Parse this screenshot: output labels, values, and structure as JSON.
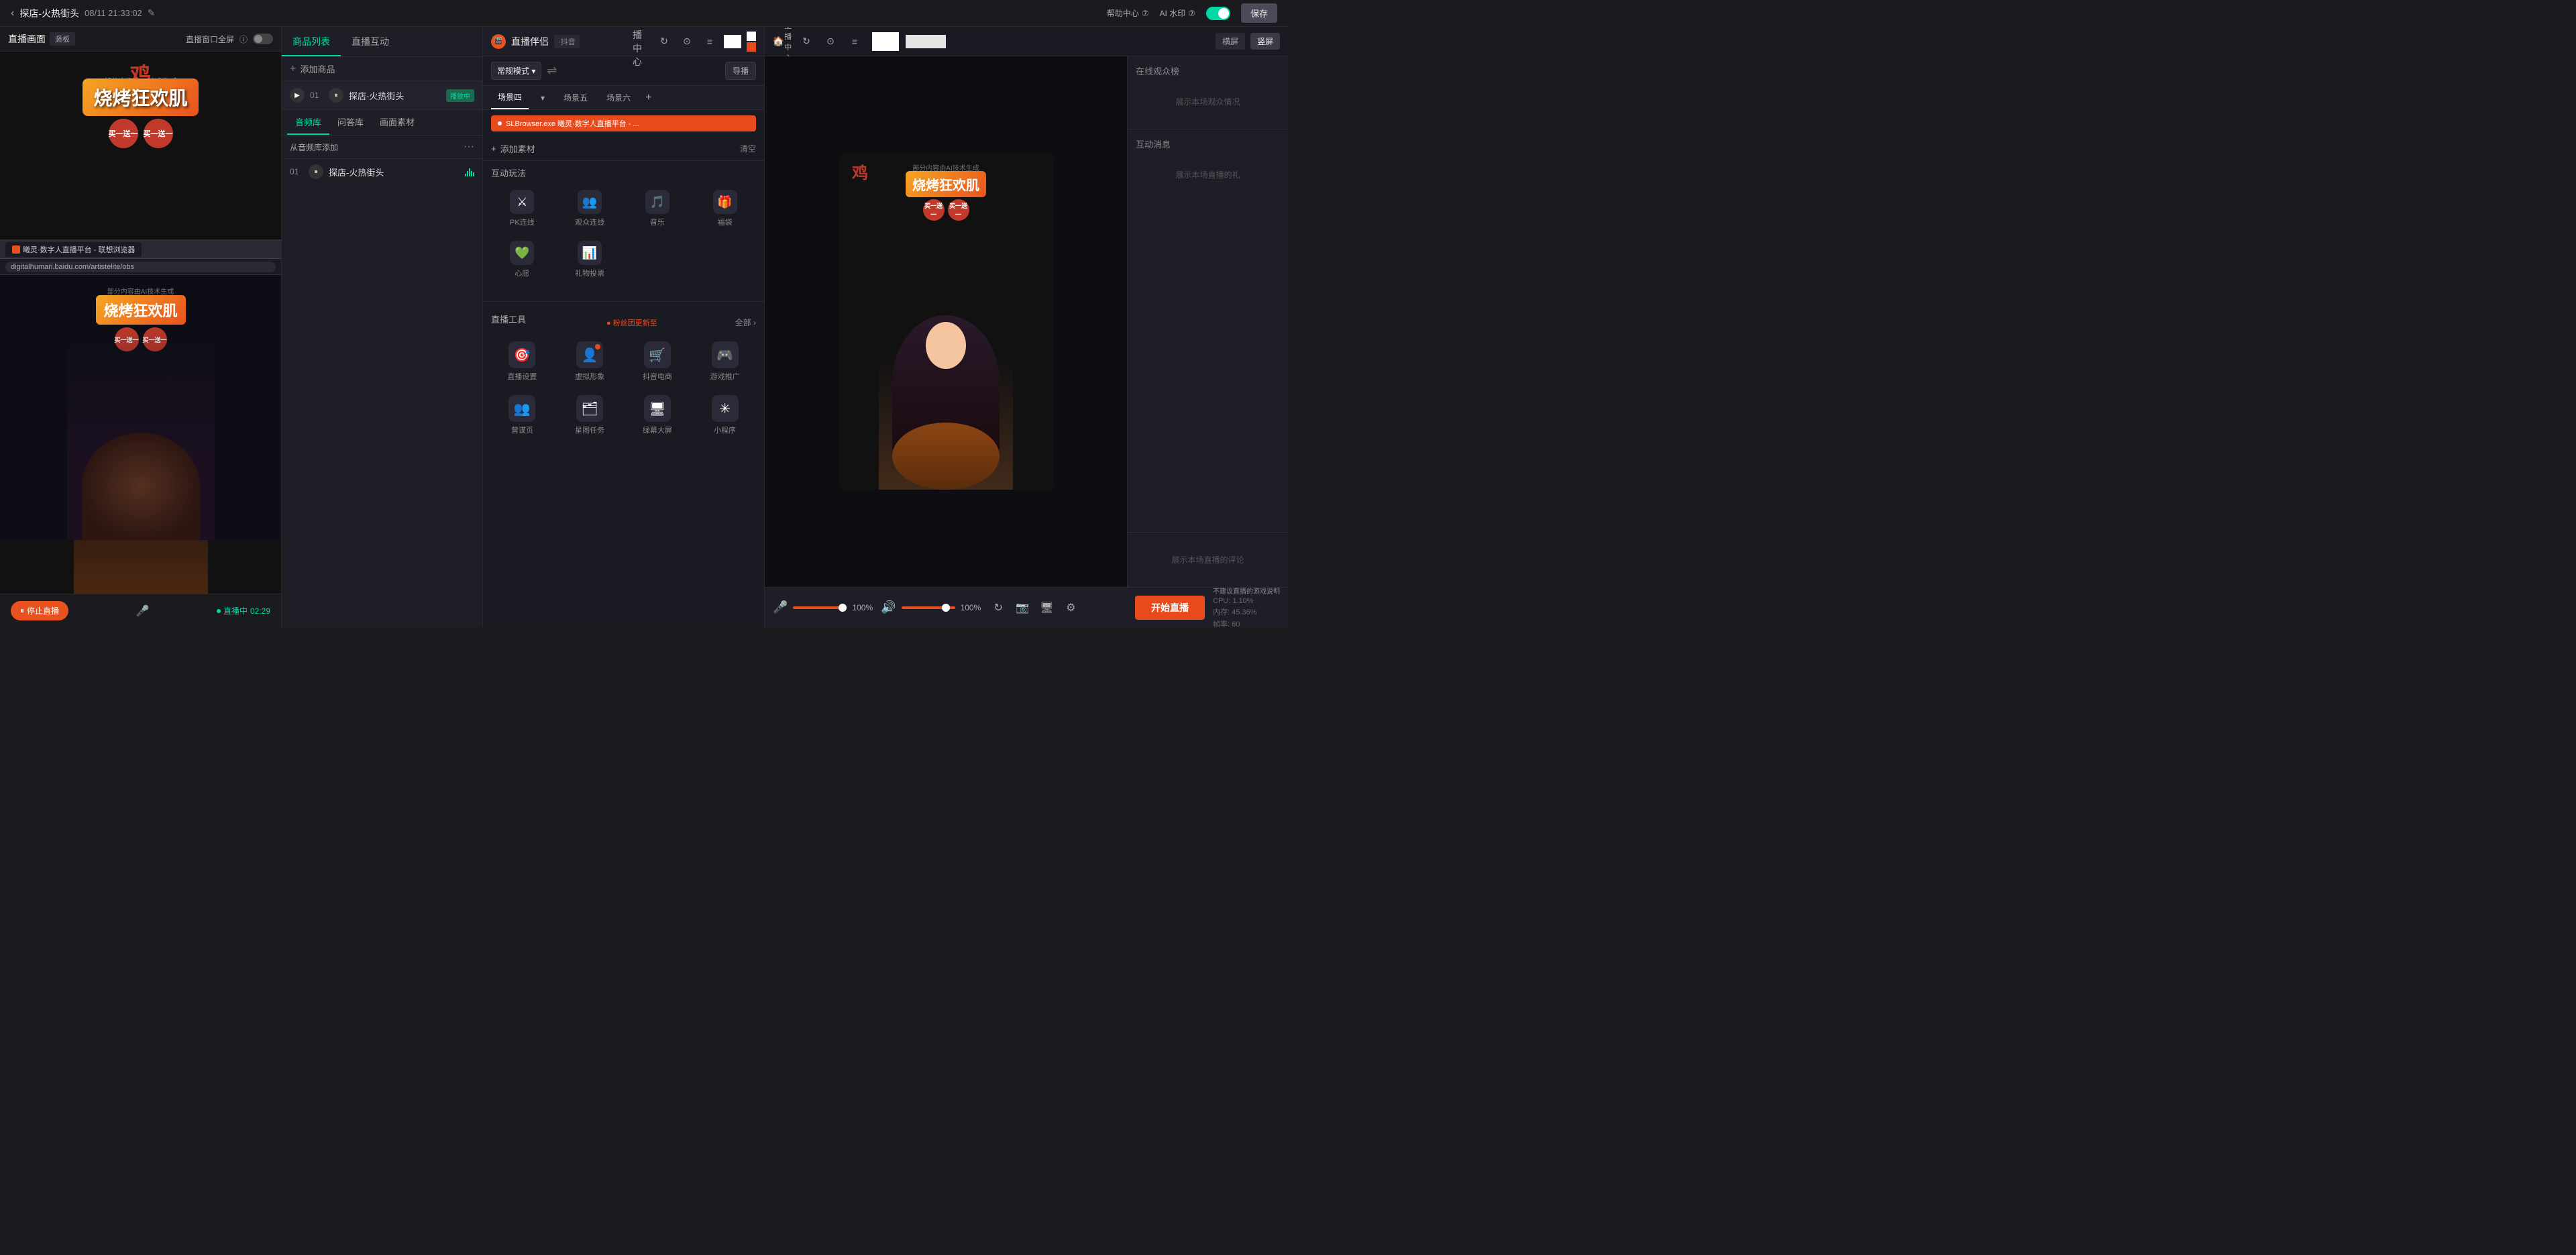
{
  "topBar": {
    "backArrow": "‹",
    "title": "探店-火热街头",
    "date": "08/11 21:33:02",
    "editIcon": "✎",
    "helpLabel": "帮助中心",
    "aiWaterLabel": "AI 水印",
    "saveLabel": "保存"
  },
  "leftPanel": {
    "title": "直播画面",
    "ratioLabel": "竖板",
    "fullscreenLabel": "直播窗口全屏",
    "aiText": "部分内容由AI技术生成",
    "bbqMainText": "烧烤狂欢肌",
    "bbqSub1": "买一送一",
    "bbqSub2": "买一送一",
    "browserTitle": "曦灵·数字人直播平台 - 联想浏览器",
    "browserUrl": "digitalhuman.baidu.com/artistelite/obs",
    "innerAiText": "部分内容由AI技术生成",
    "innerBbqText": "烧烤狂欢肌",
    "stopLiveLabel": "停止直播",
    "liveTimerLabel": "直播中",
    "liveTime": "02:29"
  },
  "middlePanel": {
    "tab1": "商品列表",
    "tab2": "直播互动",
    "addProductLabel": "添加商品",
    "product1Num": "01",
    "product1Name": "探店-火热街头",
    "product1Status": "播放中",
    "subTab1": "音频库",
    "subTab2": "问答库",
    "subTab3": "画面素材",
    "addFromLib": "从音频库添加",
    "audio1Num": "01",
    "audio1Name": "探店-火热街头",
    "audio1Bars": [
      4,
      8,
      12,
      8,
      6
    ]
  },
  "companion": {
    "title": "直播伴侣",
    "platform": "·抖音",
    "mainCenterLabel": "主播中心",
    "modeLabel": "常规模式",
    "exportLabel": "导播",
    "sceneLabel": "场景四",
    "scene2": "场景五",
    "scene3": "场景六",
    "sourcePill": "SLBrowser.exe 曦灵·数字人直播平台 - ...",
    "addMaterialLabel": "添加素材",
    "clearLabel": "清空",
    "interactionTitle": "互动玩法",
    "interactions": [
      {
        "icon": "⚔",
        "label": "PK连线"
      },
      {
        "icon": "👥",
        "label": "观众连线"
      },
      {
        "icon": "🎵",
        "label": "音乐"
      },
      {
        "icon": "🎁",
        "label": "福袋"
      },
      {
        "icon": "💚",
        "label": "心愿"
      },
      {
        "icon": "📊",
        "label": "礼物投票"
      }
    ],
    "toolsTitle": "直播工具",
    "toolsNewLabel": "粉丝团更新至",
    "toolsViewAll": "全部",
    "tools": [
      {
        "icon": "🎯",
        "label": "直播设置",
        "hasDot": false
      },
      {
        "icon": "👤",
        "label": "虚拟形象",
        "hasDot": true
      },
      {
        "icon": "🛒",
        "label": "抖音电商",
        "hasDot": false
      },
      {
        "icon": "🎮",
        "label": "游戏推广",
        "hasDot": false
      },
      {
        "icon": "👥",
        "label": "营谋页",
        "hasDot": false
      },
      {
        "icon": "🗂",
        "label": "星图任务",
        "hasDot": false
      },
      {
        "icon": "🖥",
        "label": "绿幕大屏",
        "hasDot": false
      },
      {
        "icon": "✳",
        "label": "小程序",
        "hasDot": false
      }
    ]
  },
  "rightPanel": {
    "viewTabs": [
      "横屏",
      "竖屏"
    ],
    "activeViewTab": "竖屏",
    "aiText": "部分内容由AI技术生成",
    "bbqText": "烧烤狂欢肌",
    "viewersTitle": "在线观众榜",
    "viewersHint": "展示本场观众情况",
    "messagesTitle": "互动消息",
    "messagesHint": "展示本场直播的礼",
    "commentsTitle": "",
    "commentsHint": "展示本场直播的评论",
    "startLiveLabel": "开始直播",
    "micVolume": "100%",
    "speakerVolume": "100%",
    "statsWarning": "不建议直播的游戏说明",
    "cpuLabel": "CPU: 1.10%",
    "ramLabel": "内存: 45.36%",
    "fpsLabel": "帧率: 60"
  }
}
